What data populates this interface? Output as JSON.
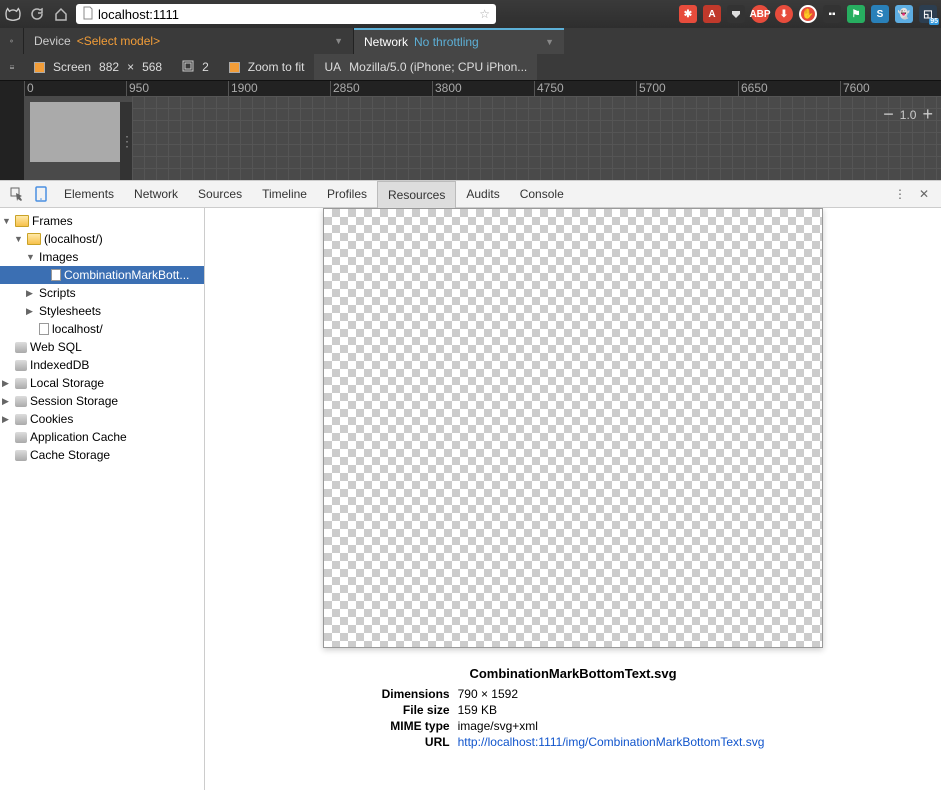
{
  "browser": {
    "url": "localhost:1111"
  },
  "deviceToolbar": {
    "deviceLabel": "Device",
    "modelPlaceholder": "<Select model>",
    "networkLabel": "Network",
    "throttling": "No throttling",
    "screenLabel": "Screen",
    "width": "882",
    "times": "×",
    "height": "568",
    "dpr": "2",
    "zoomLabel": "Zoom to fit",
    "uaLabel": "UA",
    "uaValue": "Mozilla/5.0 (iPhone; CPU iPhon..."
  },
  "ruler": [
    "0",
    "950",
    "1900",
    "2850",
    "3800",
    "4750",
    "5700",
    "6650",
    "7600"
  ],
  "zoom": "1.0",
  "tabs": [
    "Elements",
    "Network",
    "Sources",
    "Timeline",
    "Profiles",
    "Resources",
    "Audits",
    "Console"
  ],
  "activeTab": "Resources",
  "tree": [
    {
      "ind": 0,
      "arrow": "▼",
      "icon": "folder",
      "label": "Frames"
    },
    {
      "ind": 1,
      "arrow": "▼",
      "icon": "folder",
      "label": "(localhost/)"
    },
    {
      "ind": 2,
      "arrow": "▼",
      "icon": "none",
      "label": "Images"
    },
    {
      "ind": 3,
      "arrow": "",
      "icon": "file",
      "label": "CombinationMarkBott...",
      "sel": true
    },
    {
      "ind": 2,
      "arrow": "▶",
      "icon": "none",
      "label": "Scripts"
    },
    {
      "ind": 2,
      "arrow": "▶",
      "icon": "none",
      "label": "Stylesheets"
    },
    {
      "ind": 2,
      "arrow": "",
      "icon": "file",
      "label": "localhost/"
    },
    {
      "ind": 0,
      "arrow": "",
      "icon": "db",
      "label": "Web SQL"
    },
    {
      "ind": 0,
      "arrow": "",
      "icon": "db",
      "label": "IndexedDB"
    },
    {
      "ind": 0,
      "arrow": "▶",
      "icon": "db",
      "label": "Local Storage"
    },
    {
      "ind": 0,
      "arrow": "▶",
      "icon": "db",
      "label": "Session Storage"
    },
    {
      "ind": 0,
      "arrow": "▶",
      "icon": "db",
      "label": "Cookies"
    },
    {
      "ind": 0,
      "arrow": "",
      "icon": "db",
      "label": "Application Cache"
    },
    {
      "ind": 0,
      "arrow": "",
      "icon": "db",
      "label": "Cache Storage"
    }
  ],
  "resource": {
    "name": "CombinationMarkBottomText.svg",
    "dimLabel": "Dimensions",
    "dimensions": "790 × 1592",
    "sizeLabel": "File size",
    "size": "159 KB",
    "mimeLabel": "MIME type",
    "mime": "image/svg+xml",
    "urlLabel": "URL",
    "url": "http://localhost:1111/img/CombinationMarkBottomText.svg"
  }
}
